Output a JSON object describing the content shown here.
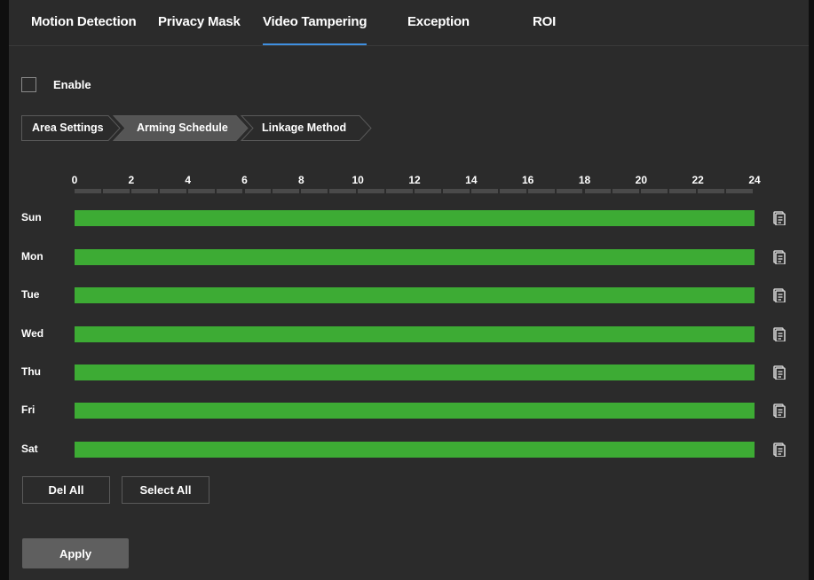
{
  "tabs": [
    {
      "label": "Motion Detection",
      "active": false
    },
    {
      "label": "Privacy Mask",
      "active": false
    },
    {
      "label": "Video Tampering",
      "active": true
    },
    {
      "label": "Exception",
      "active": false
    },
    {
      "label": "ROI",
      "active": false
    }
  ],
  "enable": {
    "label": "Enable",
    "checked": false
  },
  "steps": [
    {
      "label": "Area Settings",
      "active": false
    },
    {
      "label": "Arming Schedule",
      "active": true
    },
    {
      "label": "Linkage Method",
      "active": false
    }
  ],
  "schedule": {
    "hours": [
      "0",
      "2",
      "4",
      "6",
      "8",
      "10",
      "12",
      "14",
      "16",
      "18",
      "20",
      "22",
      "24"
    ],
    "days": [
      {
        "label": "Sun",
        "start": 0,
        "end": 24
      },
      {
        "label": "Mon",
        "start": 0,
        "end": 24
      },
      {
        "label": "Tue",
        "start": 0,
        "end": 24
      },
      {
        "label": "Wed",
        "start": 0,
        "end": 24
      },
      {
        "label": "Thu",
        "start": 0,
        "end": 24
      },
      {
        "label": "Fri",
        "start": 0,
        "end": 24
      },
      {
        "label": "Sat",
        "start": 0,
        "end": 24
      }
    ],
    "copy_icon": "copy-icon"
  },
  "buttons": {
    "del_all": "Del All",
    "select_all": "Select All",
    "apply": "Apply"
  },
  "colors": {
    "background": "#2b2b2b",
    "schedule_bar": "#3dab34",
    "active_tab_underline": "#3f8fe0",
    "active_step": "#555555",
    "apply_button": "#5f5f5f"
  }
}
